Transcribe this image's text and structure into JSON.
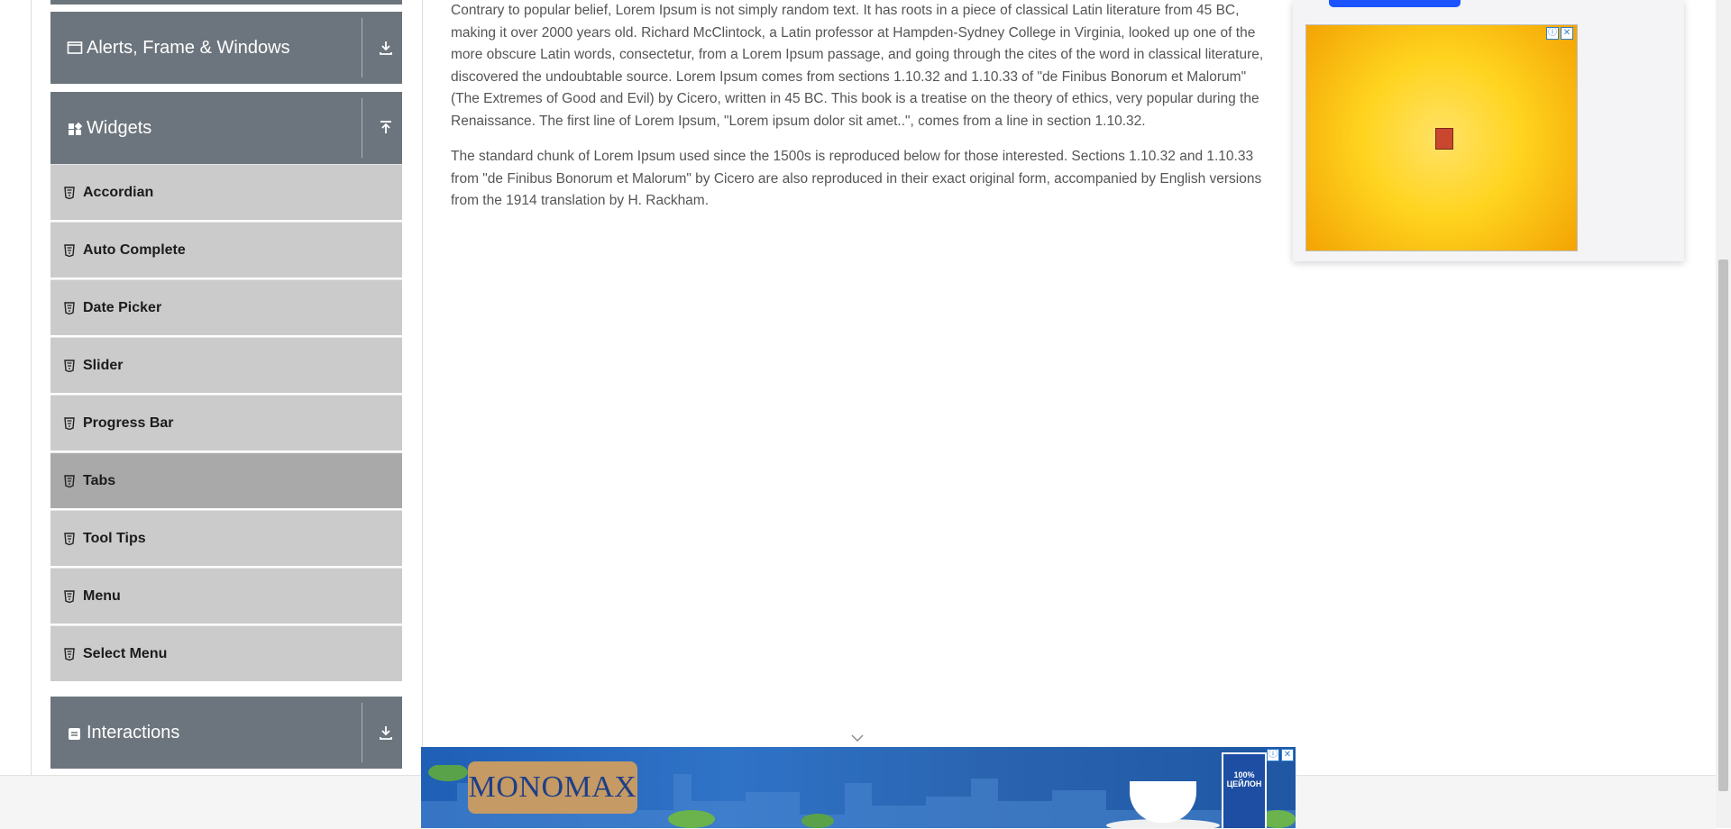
{
  "sidebar": {
    "groups": [
      {
        "label": "Alerts, Frame & Windows",
        "icon": "window-icon",
        "toggle": "download-icon"
      },
      {
        "label": "Widgets",
        "icon": "grid-icon",
        "toggle": "upload-icon"
      },
      {
        "label": "Interactions",
        "icon": "interactions-icon",
        "toggle": "download-icon"
      }
    ],
    "items": [
      {
        "label": "Accordian"
      },
      {
        "label": "Auto Complete"
      },
      {
        "label": "Date Picker"
      },
      {
        "label": "Slider"
      },
      {
        "label": "Progress Bar"
      },
      {
        "label": "Tabs"
      },
      {
        "label": "Tool Tips"
      },
      {
        "label": "Menu"
      },
      {
        "label": "Select Menu"
      }
    ],
    "active_item": "Tabs"
  },
  "content": {
    "paragraphs": [
      "Contrary to popular belief, Lorem Ipsum is not simply random text. It has roots in a piece of classical Latin literature from 45 BC, making it over 2000 years old. Richard McClintock, a Latin professor at Hampden-Sydney College in Virginia, looked up one of the more obscure Latin words, consectetur, from a Lorem Ipsum passage, and going through the cites of the word in classical literature, discovered the undoubtable source. Lorem Ipsum comes from sections 1.10.32 and 1.10.33 of \"de Finibus Bonorum et Malorum\" (The Extremes of Good and Evil) by Cicero, written in 45 BC. This book is a treatise on the theory of ethics, very popular during the Renaissance. The first line of Lorem Ipsum, \"Lorem ipsum dolor sit amet..\", comes from a line in section 1.10.32.",
      "The standard chunk of Lorem Ipsum used since the 1500s is reproduced below for those interested. Sections 1.10.32 and 1.10.33 from \"de Finibus Bonorum et Malorum\" by Cicero are also reproduced in their exact original form, accompanied by English versions from the 1914 translation by H. Rackham."
    ]
  },
  "ads": {
    "banner_logo": "MONOMAX",
    "banner_box_text": "100% ЦЕЙЛОН",
    "ad_info_glyph": "ⓘ",
    "ad_close_glyph": "✕"
  },
  "colors": {
    "group_header": "#6c757d",
    "menu_item": "#cbcbcb",
    "menu_item_active": "#a9a9a9"
  }
}
